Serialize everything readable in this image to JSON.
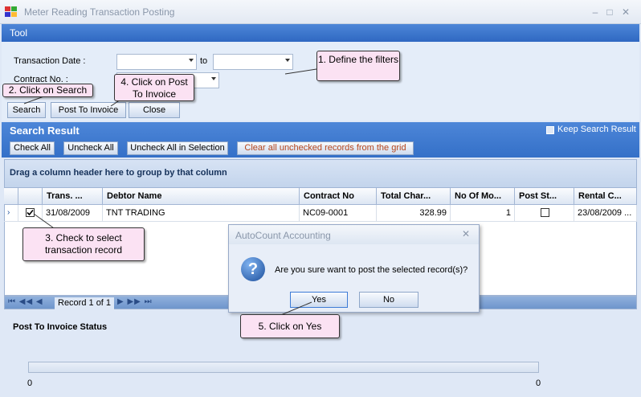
{
  "window": {
    "title": "Meter Reading Transaction Posting"
  },
  "toolstrip": {
    "label": "Tool"
  },
  "filters": {
    "transaction_date_label": "Transaction Date :",
    "date_from": "",
    "to_label": "to",
    "date_to": "",
    "contract_no_label": "Contract No. :",
    "contract_no": ""
  },
  "buttons": {
    "search": "Search",
    "post_to_invoice": "Post To Invoice",
    "close": "Close"
  },
  "result": {
    "title": "Search Result",
    "keep_search_label": "Keep Search Result",
    "check_all": "Check All",
    "uncheck_all": "Uncheck All",
    "uncheck_all_selection": "Uncheck All in Selection",
    "clear_unchecked": "Clear all unchecked records from the grid"
  },
  "grid": {
    "group_text": "Drag a column header here to group by that column",
    "columns": [
      "Trans. ...",
      "Debtor Name",
      "Contract No",
      "Total Char...",
      "No Of Mo...",
      "Post St...",
      "Rental C..."
    ],
    "rows": [
      {
        "checked": true,
        "trans_date": "31/08/2009",
        "debtor_name": "TNT TRADING",
        "contract_no": "NC09-0001",
        "total_charge": "328.99",
        "no_of_months": "1",
        "posted": false,
        "rental_date": "23/08/2009 ..."
      }
    ],
    "record_label": "Record 1 of 1"
  },
  "status": {
    "label": "Post To Invoice Status",
    "progress_min": "0",
    "progress_max": "0",
    "progress_value": 0
  },
  "dialog": {
    "title": "AutoCount Accounting",
    "message": "Are you sure want to post the selected record(s)?",
    "yes": "Yes",
    "no": "No"
  },
  "callouts": {
    "define_filters": "1. Define the filters",
    "click_search": "2. Click on Search",
    "check_record": "3. Check to select transaction record",
    "click_post": "4. Click on Post To Invoice",
    "click_yes": "5. Click on Yes"
  },
  "colors": {
    "accent": "#3470c8",
    "callout": "#fbe2f3",
    "background": "#dfe8f6"
  }
}
